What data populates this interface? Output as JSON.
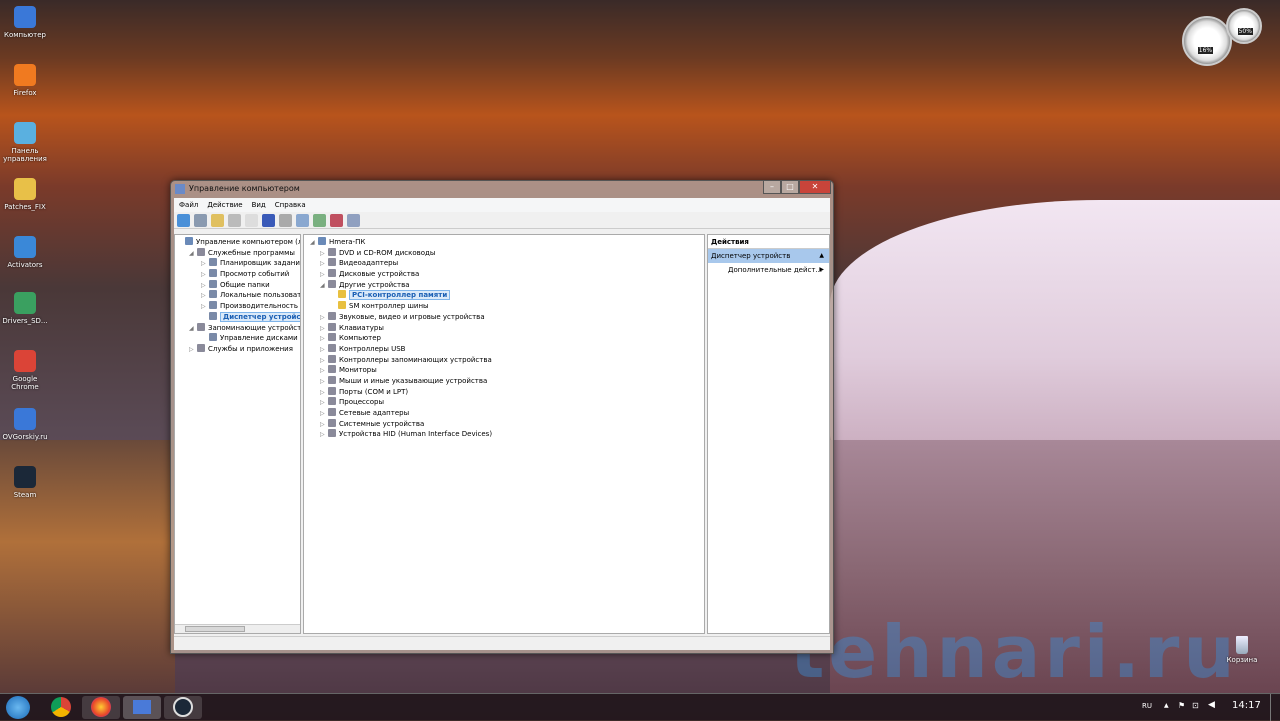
{
  "desktop": {
    "icons": [
      "Компьютер",
      "Firefox",
      "Панель управления",
      "Patches_FIX",
      "Activators",
      "Drivers_SD...",
      "Google Chrome",
      "OVGorskiy.ru",
      "Steam"
    ],
    "recycle_bin": "Корзина",
    "watermark": "tehnari.ru"
  },
  "gadgets": {
    "cpu": "16%",
    "ram": "50%"
  },
  "window": {
    "title": "Управление компьютером",
    "menu": [
      "Файл",
      "Действие",
      "Вид",
      "Справка"
    ],
    "left_tree": [
      {
        "label": "Управление компьютером (лока",
        "level": 0,
        "arrow": ""
      },
      {
        "label": "Служебные программы",
        "level": 1,
        "arrow": "◢"
      },
      {
        "label": "Планировщик заданий",
        "level": 2,
        "arrow": "▷"
      },
      {
        "label": "Просмотр событий",
        "level": 2,
        "arrow": "▷"
      },
      {
        "label": "Общие папки",
        "level": 2,
        "arrow": "▷"
      },
      {
        "label": "Локальные пользовател",
        "level": 2,
        "arrow": "▷"
      },
      {
        "label": "Производительность",
        "level": 2,
        "arrow": "▷"
      },
      {
        "label": "Диспетчер устройств",
        "level": 2,
        "arrow": "",
        "selected": true
      },
      {
        "label": "Запоминающие устройства",
        "level": 1,
        "arrow": "◢"
      },
      {
        "label": "Управление дисками",
        "level": 2,
        "arrow": ""
      },
      {
        "label": "Службы и приложения",
        "level": 1,
        "arrow": "▷"
      }
    ],
    "device_tree": [
      {
        "label": "Hmera-ПК",
        "level": 0,
        "arrow": "◢"
      },
      {
        "label": "DVD и CD-ROM дисководы",
        "level": 1,
        "arrow": "▷"
      },
      {
        "label": "Видеоадаптеры",
        "level": 1,
        "arrow": "▷"
      },
      {
        "label": "Дисковые устройства",
        "level": 1,
        "arrow": "▷"
      },
      {
        "label": "Другие устройства",
        "level": 1,
        "arrow": "◢"
      },
      {
        "label": "PCI-контроллер памяти",
        "level": 2,
        "arrow": "",
        "selected": true,
        "warn": true
      },
      {
        "label": "SM контроллер шины",
        "level": 2,
        "arrow": "",
        "warn": true
      },
      {
        "label": "Звуковые, видео и игровые устройства",
        "level": 1,
        "arrow": "▷"
      },
      {
        "label": "Клавиатуры",
        "level": 1,
        "arrow": "▷"
      },
      {
        "label": "Компьютер",
        "level": 1,
        "arrow": "▷"
      },
      {
        "label": "Контроллеры USB",
        "level": 1,
        "arrow": "▷"
      },
      {
        "label": "Контроллеры запоминающих устройства",
        "level": 1,
        "arrow": "▷"
      },
      {
        "label": "Мониторы",
        "level": 1,
        "arrow": "▷"
      },
      {
        "label": "Мыши и иные указывающие устройства",
        "level": 1,
        "arrow": "▷"
      },
      {
        "label": "Порты (COM и LPT)",
        "level": 1,
        "arrow": "▷"
      },
      {
        "label": "Процессоры",
        "level": 1,
        "arrow": "▷"
      },
      {
        "label": "Сетевые адаптеры",
        "level": 1,
        "arrow": "▷"
      },
      {
        "label": "Системные устройства",
        "level": 1,
        "arrow": "▷"
      },
      {
        "label": "Устройства HID (Human Interface Devices)",
        "level": 1,
        "arrow": "▷"
      }
    ],
    "actions": {
      "header": "Действия",
      "section": "Диспетчер устройств",
      "more": "Дополнительные дейст..."
    }
  },
  "tray": {
    "lang": "RU",
    "time": "14:17"
  }
}
